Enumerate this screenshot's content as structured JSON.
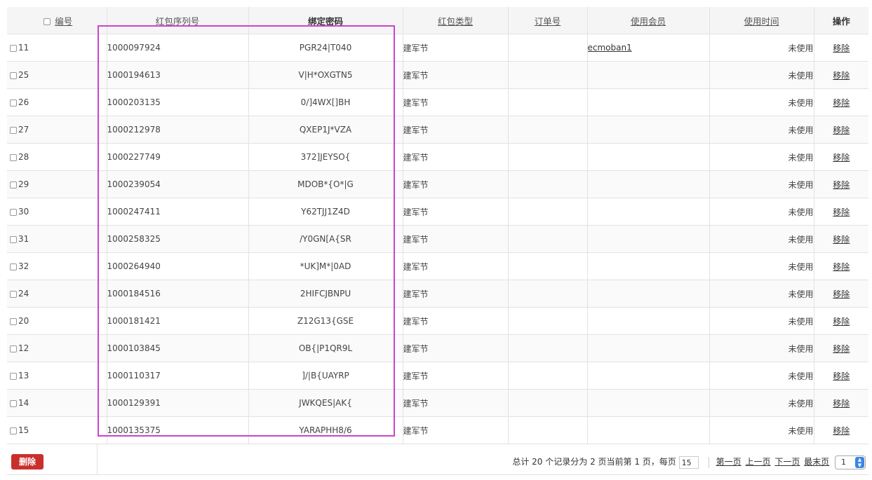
{
  "headers": {
    "id": "编号",
    "serial": "红包序列号",
    "password": "绑定密码",
    "type": "红包类型",
    "order": "订单号",
    "member": "使用会员",
    "time": "使用时间",
    "action": "操作"
  },
  "rows": [
    {
      "id": "11",
      "serial": "1000097924",
      "password": "PGR24|T040",
      "type": "建军节",
      "order": "",
      "member": "ecmoban1",
      "time": "未使用",
      "action": "移除"
    },
    {
      "id": "25",
      "serial": "1000194613",
      "password": "V|H*OXGTN5",
      "type": "建军节",
      "order": "",
      "member": "",
      "time": "未使用",
      "action": "移除"
    },
    {
      "id": "26",
      "serial": "1000203135",
      "password": "0/]4WX[]BH",
      "type": "建军节",
      "order": "",
      "member": "",
      "time": "未使用",
      "action": "移除"
    },
    {
      "id": "27",
      "serial": "1000212978",
      "password": "QXEP1J*VZA",
      "type": "建军节",
      "order": "",
      "member": "",
      "time": "未使用",
      "action": "移除"
    },
    {
      "id": "28",
      "serial": "1000227749",
      "password": "372]JEYSO{",
      "type": "建军节",
      "order": "",
      "member": "",
      "time": "未使用",
      "action": "移除"
    },
    {
      "id": "29",
      "serial": "1000239054",
      "password": "MDOB*{O*|G",
      "type": "建军节",
      "order": "",
      "member": "",
      "time": "未使用",
      "action": "移除"
    },
    {
      "id": "30",
      "serial": "1000247411",
      "password": "Y62TJJ1Z4D",
      "type": "建军节",
      "order": "",
      "member": "",
      "time": "未使用",
      "action": "移除"
    },
    {
      "id": "31",
      "serial": "1000258325",
      "password": "/Y0GN[A{SR",
      "type": "建军节",
      "order": "",
      "member": "",
      "time": "未使用",
      "action": "移除"
    },
    {
      "id": "32",
      "serial": "1000264940",
      "password": "*UK]M*|0AD",
      "type": "建军节",
      "order": "",
      "member": "",
      "time": "未使用",
      "action": "移除"
    },
    {
      "id": "24",
      "serial": "1000184516",
      "password": "2HIFCJBNPU",
      "type": "建军节",
      "order": "",
      "member": "",
      "time": "未使用",
      "action": "移除"
    },
    {
      "id": "20",
      "serial": "1000181421",
      "password": "Z12G13{GSE",
      "type": "建军节",
      "order": "",
      "member": "",
      "time": "未使用",
      "action": "移除"
    },
    {
      "id": "12",
      "serial": "1000103845",
      "password": "OB{|P1QR9L",
      "type": "建军节",
      "order": "",
      "member": "",
      "time": "未使用",
      "action": "移除"
    },
    {
      "id": "13",
      "serial": "1000110317",
      "password": "]/|B{UAYRP",
      "type": "建军节",
      "order": "",
      "member": "",
      "time": "未使用",
      "action": "移除"
    },
    {
      "id": "14",
      "serial": "1000129391",
      "password": "JWKQES|AK{",
      "type": "建军节",
      "order": "",
      "member": "",
      "time": "未使用",
      "action": "移除"
    },
    {
      "id": "15",
      "serial": "1000135375",
      "password": "YARAPHH8/6",
      "type": "建军节",
      "order": "",
      "member": "",
      "time": "未使用",
      "action": "移除"
    }
  ],
  "footer": {
    "delete_label": "删除",
    "summary": "总计 20 个记录分为 2 页当前第 1 页，每页",
    "page_size": "15",
    "first": "第一页",
    "prev": "上一页",
    "next": "下一页",
    "last": "最末页",
    "page_select": "1"
  },
  "colors": {
    "highlight": "#cc44cc",
    "delete_button": "#c9302c",
    "select_arrow": "#3a86e6"
  }
}
